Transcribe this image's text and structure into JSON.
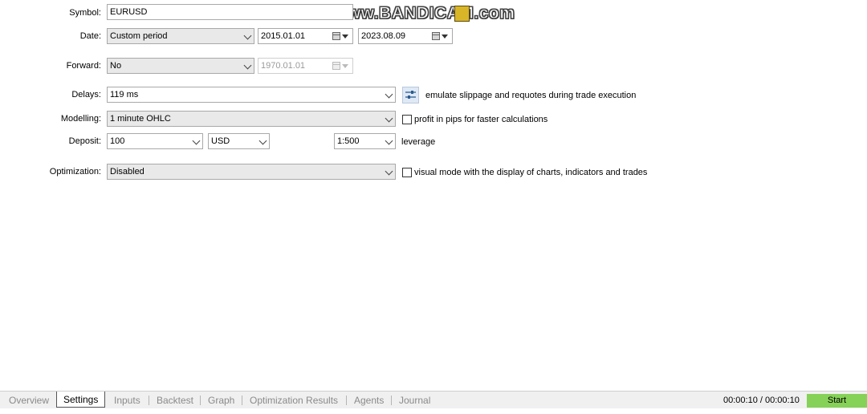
{
  "watermark": "www.BANDICAM.com",
  "form": {
    "symbol": {
      "label": "Symbol:",
      "value": "EURUSD"
    },
    "date": {
      "label": "Date:",
      "mode": "Custom period",
      "from": "2015.01.01",
      "to": "2023.08.09"
    },
    "forward": {
      "label": "Forward:",
      "mode": "No",
      "date": "1970.01.01"
    },
    "delays": {
      "label": "Delays:",
      "value": "119 ms",
      "note": "emulate slippage and requotes during trade execution"
    },
    "modelling": {
      "label": "Modelling:",
      "value": "1 minute OHLC",
      "checkbox_label": "profit in pips for faster calculations",
      "checked": false
    },
    "deposit": {
      "label": "Deposit:",
      "amount": "100",
      "currency": "USD",
      "leverage_value": "1:500",
      "leverage_label": "leverage"
    },
    "optimization": {
      "label": "Optimization:",
      "value": "Disabled",
      "checkbox_label": "visual mode with the display of charts, indicators and trades",
      "checked": false
    }
  },
  "tabs": [
    "Overview",
    "Settings",
    "Inputs",
    "Backtest",
    "Graph",
    "Optimization Results",
    "Agents",
    "Journal"
  ],
  "active_tab": "Settings",
  "timer": "00:00:10 / 00:00:10",
  "start_label": "Start",
  "colors": {
    "start_button": "#86d158",
    "icon_button": "#dfe9f5"
  }
}
